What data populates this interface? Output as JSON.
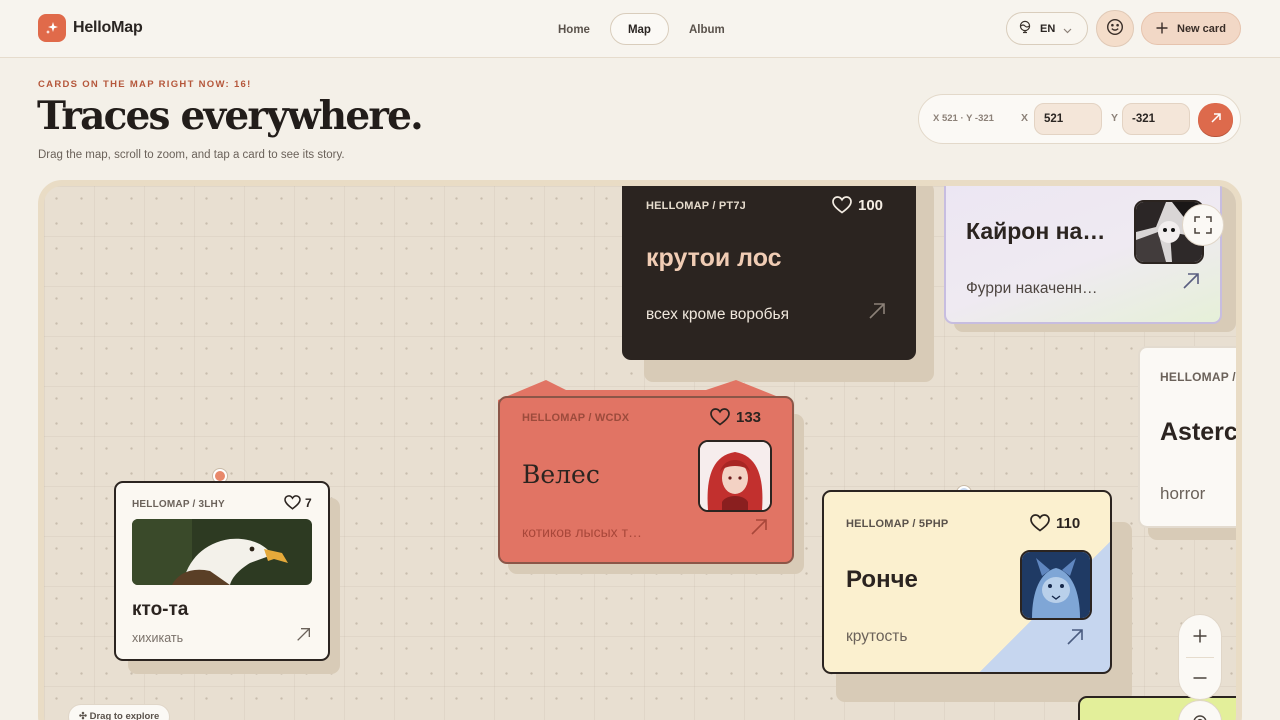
{
  "app": {
    "name": "HelloMap"
  },
  "nav": {
    "items": [
      {
        "label": "Home"
      },
      {
        "label": "Map"
      },
      {
        "label": "Album"
      }
    ]
  },
  "header": {
    "language": "EN",
    "new_card_label": "New card"
  },
  "hero": {
    "eyebrow": "CARDS ON THE MAP RIGHT NOW: 16!",
    "title": "Traces everywhere.",
    "subtitle": "Drag the map, scroll to zoom, and tap a card to see its story."
  },
  "coords": {
    "readout": "X 521 · Y -321",
    "x_label": "X",
    "y_label": "Y",
    "x_value": "521",
    "y_value": "-321"
  },
  "map": {
    "hint": "✣ Drag to explore"
  },
  "cards": [
    {
      "id": "HELLOMAP / PT7J",
      "likes": "100",
      "title": "крутои лос",
      "subtitle": "всех кроме воробья",
      "color": "#2b2420"
    },
    {
      "id": "",
      "likes": "",
      "title": "Кайрон на…",
      "subtitle": "Фурри накаченн…",
      "color": "#efeaf4"
    },
    {
      "id": "HELLOMAP / WCDX",
      "likes": "133",
      "title": "Велес",
      "subtitle": "котиков лысых т…",
      "color": "#e17464"
    },
    {
      "id": "HELLOMAP / 3LHY",
      "likes": "7",
      "title": "кто-та",
      "subtitle": "хихикать",
      "color": "#fbf8f2"
    },
    {
      "id": "HELLOMAP / 5PHP",
      "likes": "110",
      "title": "Ронче",
      "subtitle": "крутость",
      "color": "#fbf0cf"
    },
    {
      "id": "HELLOMAP /",
      "likes": "",
      "title": "Asterc",
      "subtitle": "horror",
      "color": "#fbf9f5"
    }
  ],
  "colors": {
    "accent": "#dd6a4c",
    "background": "#f4f0e8",
    "map": "#e8dfd1"
  }
}
